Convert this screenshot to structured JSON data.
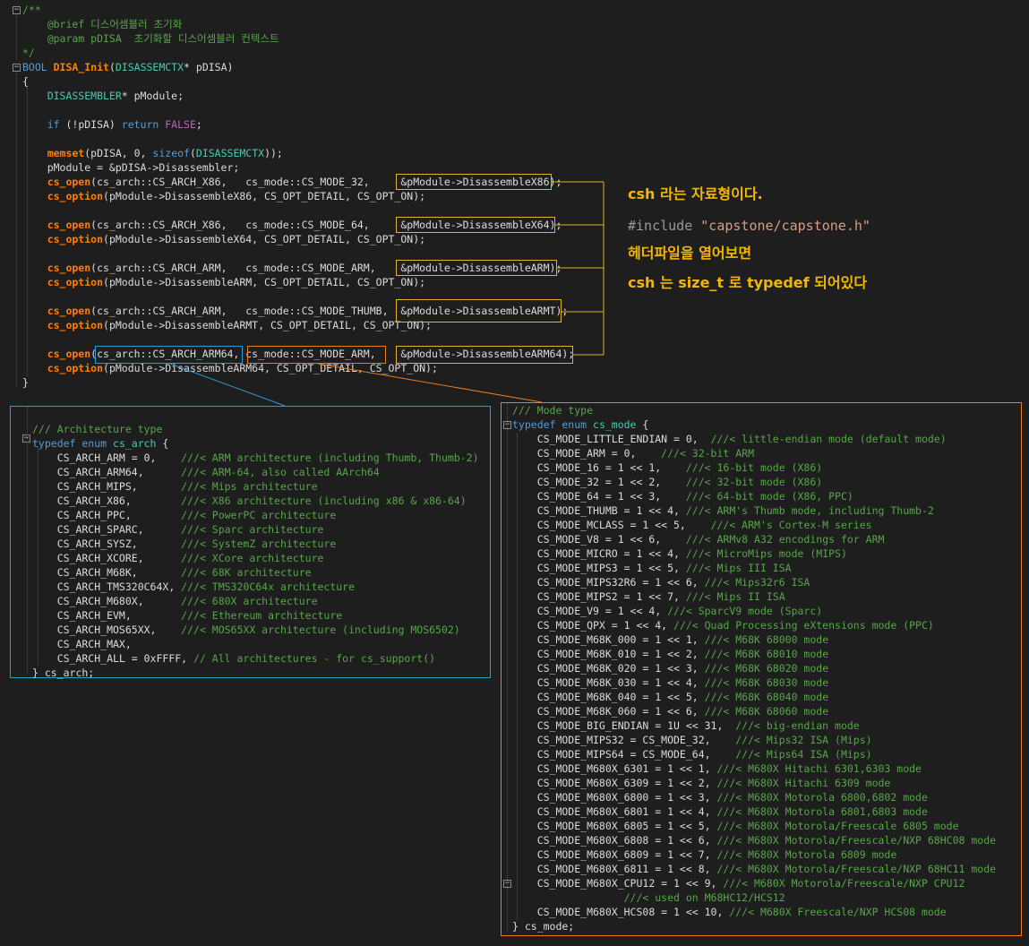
{
  "top": {
    "lines": [
      {
        "parts": [
          [
            "cm",
            "/**"
          ]
        ]
      },
      {
        "parts": [
          [
            "cm",
            "    @brief 디스어셈블러 초기화"
          ]
        ]
      },
      {
        "parts": [
          [
            "cm",
            "    @param pDISA  초기화할 디스어셈블러 컨텍스트"
          ]
        ]
      },
      {
        "parts": [
          [
            "cm",
            "*/"
          ]
        ]
      },
      {
        "parts": [
          [
            "kw",
            "BOOL "
          ],
          [
            "fnb",
            "DISA_Init"
          ],
          [
            "p",
            "("
          ],
          [
            "ty",
            "DISASSEMCTX"
          ],
          [
            "p",
            "* pDISA)"
          ]
        ]
      },
      {
        "parts": [
          [
            "p",
            "{"
          ]
        ]
      },
      {
        "parts": [
          [
            "ty",
            "    DISASSEMBLER"
          ],
          [
            "p",
            "* pModule;"
          ]
        ]
      },
      {
        "parts": []
      },
      {
        "parts": [
          [
            "kw",
            "    if "
          ],
          [
            "p",
            "(!pDISA) "
          ],
          [
            "kw",
            "return "
          ],
          [
            "mac",
            "FALSE"
          ],
          [
            "p",
            ";"
          ]
        ]
      },
      {
        "parts": []
      },
      {
        "parts": [
          [
            "fnb",
            "    memset"
          ],
          [
            "p",
            "(pDISA, 0, "
          ],
          [
            "kw",
            "sizeof"
          ],
          [
            "p",
            "("
          ],
          [
            "ty",
            "DISASSEMCTX"
          ],
          [
            "p",
            "));"
          ]
        ]
      },
      {
        "parts": [
          [
            "p",
            "    pModule = &pDISA->Disassembler;"
          ]
        ]
      },
      {
        "parts": [
          [
            "fnb",
            "    cs_open"
          ],
          [
            "p",
            "(cs_arch::CS_ARCH_X86,   cs_mode::CS_MODE_32,     &pModule->DisassembleX86);"
          ]
        ]
      },
      {
        "parts": [
          [
            "fnb",
            "    cs_option"
          ],
          [
            "p",
            "(pModule->DisassembleX86, CS_OPT_DETAIL, CS_OPT_ON);"
          ]
        ]
      },
      {
        "parts": []
      },
      {
        "parts": [
          [
            "fnb",
            "    cs_open"
          ],
          [
            "p",
            "(cs_arch::CS_ARCH_X86,   cs_mode::CS_MODE_64,     &pModule->DisassembleX64);"
          ]
        ]
      },
      {
        "parts": [
          [
            "fnb",
            "    cs_option"
          ],
          [
            "p",
            "(pModule->DisassembleX64, CS_OPT_DETAIL, CS_OPT_ON);"
          ]
        ]
      },
      {
        "parts": []
      },
      {
        "parts": [
          [
            "fnb",
            "    cs_open"
          ],
          [
            "p",
            "(cs_arch::CS_ARCH_ARM,   cs_mode::CS_MODE_ARM,    &pModule->DisassembleARM);"
          ]
        ]
      },
      {
        "parts": [
          [
            "fnb",
            "    cs_option"
          ],
          [
            "p",
            "(pModule->DisassembleARM, CS_OPT_DETAIL, CS_OPT_ON);"
          ]
        ]
      },
      {
        "parts": []
      },
      {
        "parts": [
          [
            "fnb",
            "    cs_open"
          ],
          [
            "p",
            "(cs_arch::CS_ARCH_ARM,   cs_mode::CS_MODE_THUMB,  &pModule->DisassembleARMT);"
          ]
        ]
      },
      {
        "parts": [
          [
            "fnb",
            "    cs_option"
          ],
          [
            "p",
            "(pModule->DisassembleARMT, CS_OPT_DETAIL, CS_OPT_ON);"
          ]
        ]
      },
      {
        "parts": []
      },
      {
        "parts": [
          [
            "fnb",
            "    cs_open"
          ],
          [
            "p",
            "(cs_arch::CS_ARCH_ARM64, cs_mode::CS_MODE_ARM,    &pModule->DisassembleARM64);"
          ]
        ]
      },
      {
        "parts": [
          [
            "fnb",
            "    cs_option"
          ],
          [
            "p",
            "(pModule->DisassembleARM64, CS_OPT_DETAIL, CS_OPT_ON);"
          ]
        ]
      },
      {
        "parts": [
          [
            "p",
            "}"
          ]
        ]
      }
    ]
  },
  "arch": {
    "lines": [
      {
        "parts": []
      },
      {
        "parts": [
          [
            "cm",
            "/// Architecture type"
          ]
        ]
      },
      {
        "parts": [
          [
            "kw",
            "typedef enum "
          ],
          [
            "ty",
            "cs_arch"
          ],
          [
            "p",
            " {"
          ]
        ]
      },
      {
        "parts": [
          [
            "p",
            "    CS_ARCH_ARM = 0,    "
          ],
          [
            "cm",
            "///< ARM architecture (including Thumb, Thumb-2)"
          ]
        ]
      },
      {
        "parts": [
          [
            "p",
            "    CS_ARCH_ARM64,      "
          ],
          [
            "cm",
            "///< ARM-64, also called AArch64"
          ]
        ]
      },
      {
        "parts": [
          [
            "p",
            "    CS_ARCH_MIPS,       "
          ],
          [
            "cm",
            "///< Mips architecture"
          ]
        ]
      },
      {
        "parts": [
          [
            "p",
            "    CS_ARCH_X86,        "
          ],
          [
            "cm",
            "///< X86 architecture (including x86 & x86-64)"
          ]
        ]
      },
      {
        "parts": [
          [
            "p",
            "    CS_ARCH_PPC,        "
          ],
          [
            "cm",
            "///< PowerPC architecture"
          ]
        ]
      },
      {
        "parts": [
          [
            "p",
            "    CS_ARCH_SPARC,      "
          ],
          [
            "cm",
            "///< Sparc architecture"
          ]
        ]
      },
      {
        "parts": [
          [
            "p",
            "    CS_ARCH_SYSZ,       "
          ],
          [
            "cm",
            "///< SystemZ architecture"
          ]
        ]
      },
      {
        "parts": [
          [
            "p",
            "    CS_ARCH_XCORE,      "
          ],
          [
            "cm",
            "///< XCore architecture"
          ]
        ]
      },
      {
        "parts": [
          [
            "p",
            "    CS_ARCH_M68K,       "
          ],
          [
            "cm",
            "///< 68K architecture"
          ]
        ]
      },
      {
        "parts": [
          [
            "p",
            "    CS_ARCH_TMS320C64X, "
          ],
          [
            "cm",
            "///< TMS320C64x architecture"
          ]
        ]
      },
      {
        "parts": [
          [
            "p",
            "    CS_ARCH_M680X,      "
          ],
          [
            "cm",
            "///< 680X architecture"
          ]
        ]
      },
      {
        "parts": [
          [
            "p",
            "    CS_ARCH_EVM,        "
          ],
          [
            "cm",
            "///< Ethereum architecture"
          ]
        ]
      },
      {
        "parts": [
          [
            "p",
            "    CS_ARCH_MOS65XX,    "
          ],
          [
            "cm",
            "///< MOS65XX architecture (including MOS6502)"
          ]
        ]
      },
      {
        "parts": [
          [
            "p",
            "    CS_ARCH_MAX,"
          ]
        ]
      },
      {
        "parts": [
          [
            "p",
            "    CS_ARCH_ALL = 0xFFFF, "
          ],
          [
            "cm",
            "// All architectures - for cs_support()"
          ]
        ]
      },
      {
        "parts": [
          [
            "p",
            "} cs_arch;"
          ]
        ]
      }
    ]
  },
  "mode": {
    "lines": [
      {
        "parts": [
          [
            "cm",
            "/// Mode type"
          ]
        ]
      },
      {
        "parts": [
          [
            "kw",
            "typedef enum "
          ],
          [
            "ty",
            "cs_mode"
          ],
          [
            "p",
            " {"
          ]
        ]
      },
      {
        "parts": [
          [
            "p",
            "    CS_MODE_LITTLE_ENDIAN = 0,  "
          ],
          [
            "cm",
            "///< little-endian mode (default mode)"
          ]
        ]
      },
      {
        "parts": [
          [
            "p",
            "    CS_MODE_ARM = 0,    "
          ],
          [
            "cm",
            "///< 32-bit ARM"
          ]
        ]
      },
      {
        "parts": [
          [
            "p",
            "    CS_MODE_16 = 1 << 1,    "
          ],
          [
            "cm",
            "///< 16-bit mode (X86)"
          ]
        ]
      },
      {
        "parts": [
          [
            "p",
            "    CS_MODE_32 = 1 << 2,    "
          ],
          [
            "cm",
            "///< 32-bit mode (X86)"
          ]
        ]
      },
      {
        "parts": [
          [
            "p",
            "    CS_MODE_64 = 1 << 3,    "
          ],
          [
            "cm",
            "///< 64-bit mode (X86, PPC)"
          ]
        ]
      },
      {
        "parts": [
          [
            "p",
            "    CS_MODE_THUMB = 1 << 4, "
          ],
          [
            "cm",
            "///< ARM's Thumb mode, including Thumb-2"
          ]
        ]
      },
      {
        "parts": [
          [
            "p",
            "    CS_MODE_MCLASS = 1 << 5,    "
          ],
          [
            "cm",
            "///< ARM's Cortex-M series"
          ]
        ]
      },
      {
        "parts": [
          [
            "p",
            "    CS_MODE_V8 = 1 << 6,    "
          ],
          [
            "cm",
            "///< ARMv8 A32 encodings for ARM"
          ]
        ]
      },
      {
        "parts": [
          [
            "p",
            "    CS_MODE_MICRO = 1 << 4, "
          ],
          [
            "cm",
            "///< MicroMips mode (MIPS)"
          ]
        ]
      },
      {
        "parts": [
          [
            "p",
            "    CS_MODE_MIPS3 = 1 << 5, "
          ],
          [
            "cm",
            "///< Mips III ISA"
          ]
        ]
      },
      {
        "parts": [
          [
            "p",
            "    CS_MODE_MIPS32R6 = 1 << 6, "
          ],
          [
            "cm",
            "///< Mips32r6 ISA"
          ]
        ]
      },
      {
        "parts": [
          [
            "p",
            "    CS_MODE_MIPS2 = 1 << 7, "
          ],
          [
            "cm",
            "///< Mips II ISA"
          ]
        ]
      },
      {
        "parts": [
          [
            "p",
            "    CS_MODE_V9 = 1 << 4, "
          ],
          [
            "cm",
            "///< SparcV9 mode (Sparc)"
          ]
        ]
      },
      {
        "parts": [
          [
            "p",
            "    CS_MODE_QPX = 1 << 4, "
          ],
          [
            "cm",
            "///< Quad Processing eXtensions mode (PPC)"
          ]
        ]
      },
      {
        "parts": [
          [
            "p",
            "    CS_MODE_M68K_000 = 1 << 1, "
          ],
          [
            "cm",
            "///< M68K 68000 mode"
          ]
        ]
      },
      {
        "parts": [
          [
            "p",
            "    CS_MODE_M68K_010 = 1 << 2, "
          ],
          [
            "cm",
            "///< M68K 68010 mode"
          ]
        ]
      },
      {
        "parts": [
          [
            "p",
            "    CS_MODE_M68K_020 = 1 << 3, "
          ],
          [
            "cm",
            "///< M68K 68020 mode"
          ]
        ]
      },
      {
        "parts": [
          [
            "p",
            "    CS_MODE_M68K_030 = 1 << 4, "
          ],
          [
            "cm",
            "///< M68K 68030 mode"
          ]
        ]
      },
      {
        "parts": [
          [
            "p",
            "    CS_MODE_M68K_040 = 1 << 5, "
          ],
          [
            "cm",
            "///< M68K 68040 mode"
          ]
        ]
      },
      {
        "parts": [
          [
            "p",
            "    CS_MODE_M68K_060 = 1 << 6, "
          ],
          [
            "cm",
            "///< M68K 68060 mode"
          ]
        ]
      },
      {
        "parts": [
          [
            "p",
            "    CS_MODE_BIG_ENDIAN = 1U << 31,  "
          ],
          [
            "cm",
            "///< big-endian mode"
          ]
        ]
      },
      {
        "parts": [
          [
            "p",
            "    CS_MODE_MIPS32 = CS_MODE_32,    "
          ],
          [
            "cm",
            "///< Mips32 ISA (Mips)"
          ]
        ]
      },
      {
        "parts": [
          [
            "p",
            "    CS_MODE_MIPS64 = CS_MODE_64,    "
          ],
          [
            "cm",
            "///< Mips64 ISA (Mips)"
          ]
        ]
      },
      {
        "parts": [
          [
            "p",
            "    CS_MODE_M680X_6301 = 1 << 1, "
          ],
          [
            "cm",
            "///< M680X Hitachi 6301,6303 mode"
          ]
        ]
      },
      {
        "parts": [
          [
            "p",
            "    CS_MODE_M680X_6309 = 1 << 2, "
          ],
          [
            "cm",
            "///< M680X Hitachi 6309 mode"
          ]
        ]
      },
      {
        "parts": [
          [
            "p",
            "    CS_MODE_M680X_6800 = 1 << 3, "
          ],
          [
            "cm",
            "///< M680X Motorola 6800,6802 mode"
          ]
        ]
      },
      {
        "parts": [
          [
            "p",
            "    CS_MODE_M680X_6801 = 1 << 4, "
          ],
          [
            "cm",
            "///< M680X Motorola 6801,6803 mode"
          ]
        ]
      },
      {
        "parts": [
          [
            "p",
            "    CS_MODE_M680X_6805 = 1 << 5, "
          ],
          [
            "cm",
            "///< M680X Motorola/Freescale 6805 mode"
          ]
        ]
      },
      {
        "parts": [
          [
            "p",
            "    CS_MODE_M680X_6808 = 1 << 6, "
          ],
          [
            "cm",
            "///< M680X Motorola/Freescale/NXP 68HC08 mode"
          ]
        ]
      },
      {
        "parts": [
          [
            "p",
            "    CS_MODE_M680X_6809 = 1 << 7, "
          ],
          [
            "cm",
            "///< M680X Motorola 6809 mode"
          ]
        ]
      },
      {
        "parts": [
          [
            "p",
            "    CS_MODE_M680X_6811 = 1 << 8, "
          ],
          [
            "cm",
            "///< M680X Motorola/Freescale/NXP 68HC11 mode"
          ]
        ]
      },
      {
        "parts": [
          [
            "p",
            "    CS_MODE_M680X_CPU12 = 1 << 9, "
          ],
          [
            "cm",
            "///< M680X Motorola/Freescale/NXP CPU12"
          ]
        ]
      },
      {
        "parts": [
          [
            "cm",
            "                  ///< used on M68HC12/HCS12"
          ]
        ]
      },
      {
        "parts": [
          [
            "p",
            "    CS_MODE_M680X_HCS08 = 1 << 10, "
          ],
          [
            "cm",
            "///< M680X Freescale/NXP HCS08 mode"
          ]
        ]
      },
      {
        "parts": [
          [
            "p",
            "} cs_mode;"
          ]
        ]
      }
    ]
  },
  "annotation": {
    "line1": "csh 라는 자료형이다.",
    "include_kw": "#include ",
    "include_path": "\"capstone/capstone.h\"",
    "line3": "헤더파일을 열어보면",
    "line4": "csh 는 size_t 로 typedef 되어있다"
  },
  "colors": {
    "annotation": "#f2b705",
    "box_yellow": "#e6b422",
    "box_blue": "#2f9ad8",
    "box_orange": "#e67e22"
  }
}
